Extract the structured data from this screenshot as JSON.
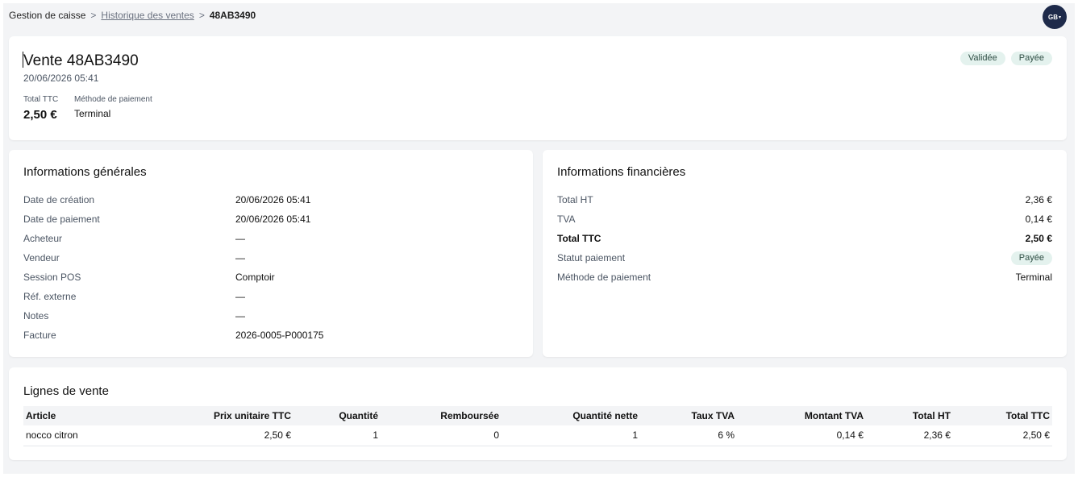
{
  "breadcrumb": {
    "root": "Gestion de caisse",
    "history": "Historique des ventes",
    "current": "48AB3490",
    "separator": ">"
  },
  "user": {
    "initials": "GB",
    "caret": "▾"
  },
  "sale": {
    "title": "Vente 48AB3490",
    "date": "20/06/2026 05:41",
    "total_label": "Total TTC",
    "total_value": "2,50 €",
    "method_label": "Méthode de paiement",
    "method_value": "Terminal",
    "badges": [
      "Validée",
      "Payée"
    ]
  },
  "general": {
    "title": "Informations générales",
    "rows": [
      {
        "label": "Date de création",
        "value": "20/06/2026 05:41"
      },
      {
        "label": "Date de paiement",
        "value": "20/06/2026 05:41"
      },
      {
        "label": "Acheteur",
        "value": "—"
      },
      {
        "label": "Vendeur",
        "value": "—"
      },
      {
        "label": "Session POS",
        "value": "Comptoir"
      },
      {
        "label": "Réf. externe",
        "value": "—"
      },
      {
        "label": "Notes",
        "value": "—"
      },
      {
        "label": "Facture",
        "value": "2026-0005-P000175"
      }
    ]
  },
  "finance": {
    "title": "Informations financières",
    "rows": [
      {
        "label": "Total HT",
        "value": "2,36 €"
      },
      {
        "label": "TVA",
        "value": "0,14 €"
      },
      {
        "label": "Total TTC",
        "value": "2,50 €"
      },
      {
        "label": "Statut paiement",
        "value": "Payée"
      },
      {
        "label": "Méthode de paiement",
        "value": "Terminal"
      }
    ]
  },
  "lines": {
    "title": "Lignes de vente",
    "columns": [
      "Article",
      "Prix unitaire TTC",
      "Quantité",
      "Remboursée",
      "Quantité nette",
      "Taux TVA",
      "Montant TVA",
      "Total HT",
      "Total TTC"
    ],
    "rows": [
      [
        "nocco citron",
        "2,50 €",
        "1",
        "0",
        "1",
        "6 %",
        "0,14 €",
        "2,36 €",
        "2,50 €"
      ]
    ]
  },
  "colors": {
    "accent": "#1e2a4a",
    "badge_bg": "#e4f2ee",
    "background": "#f3f4f6"
  }
}
